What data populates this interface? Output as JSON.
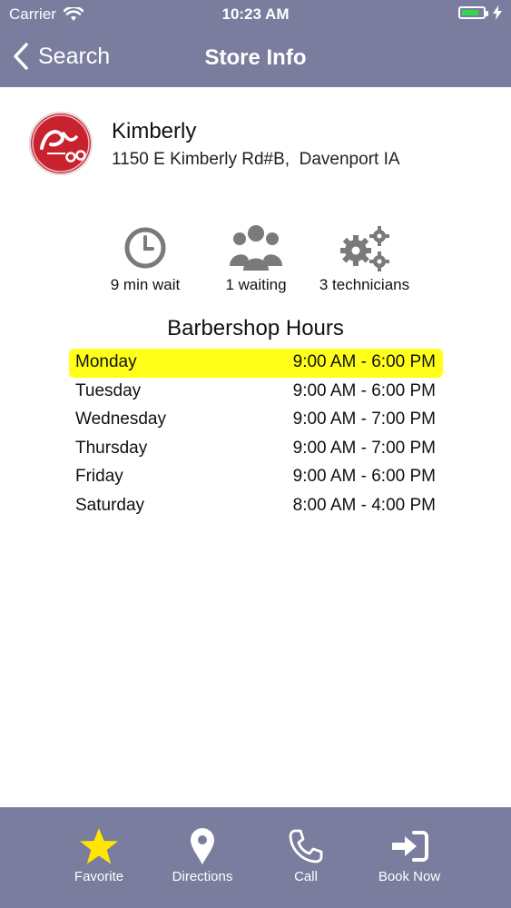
{
  "status_bar": {
    "carrier": "Carrier",
    "time": "10:23 AM",
    "battery_color": "#32d74b"
  },
  "nav": {
    "back_label": "Search",
    "title": "Store Info"
  },
  "store": {
    "name": "Kimberly",
    "address": "1150 E Kimberly Rd#B,  Davenport IA",
    "logo_color": "#c8222f"
  },
  "stats": [
    {
      "icon": "clock-icon",
      "label": "9 min wait"
    },
    {
      "icon": "people-group-icon",
      "label": "1 waiting"
    },
    {
      "icon": "gears-icon",
      "label": "3 technicians"
    }
  ],
  "hours": {
    "title": "Barbershop Hours",
    "highlight_color": "#ffff19",
    "rows": [
      {
        "day": "Monday",
        "time": "9:00 AM - 6:00 PM"
      },
      {
        "day": "Tuesday",
        "time": "9:00 AM - 6:00 PM"
      },
      {
        "day": "Wednesday",
        "time": "9:00 AM - 7:00 PM"
      },
      {
        "day": "Thursday",
        "time": "9:00 AM - 7:00 PM"
      },
      {
        "day": "Friday",
        "time": "9:00 AM - 6:00 PM"
      },
      {
        "day": "Saturday",
        "time": "8:00 AM - 4:00 PM"
      }
    ]
  },
  "tabbar": {
    "accent": "#7a7d9e",
    "favorite_icon_color": "#ffe600",
    "tabs": [
      {
        "icon": "star-icon",
        "label": "Favorite"
      },
      {
        "icon": "map-pin-icon",
        "label": "Directions"
      },
      {
        "icon": "phone-icon",
        "label": "Call"
      },
      {
        "icon": "sign-in-icon",
        "label": "Book Now"
      }
    ]
  }
}
